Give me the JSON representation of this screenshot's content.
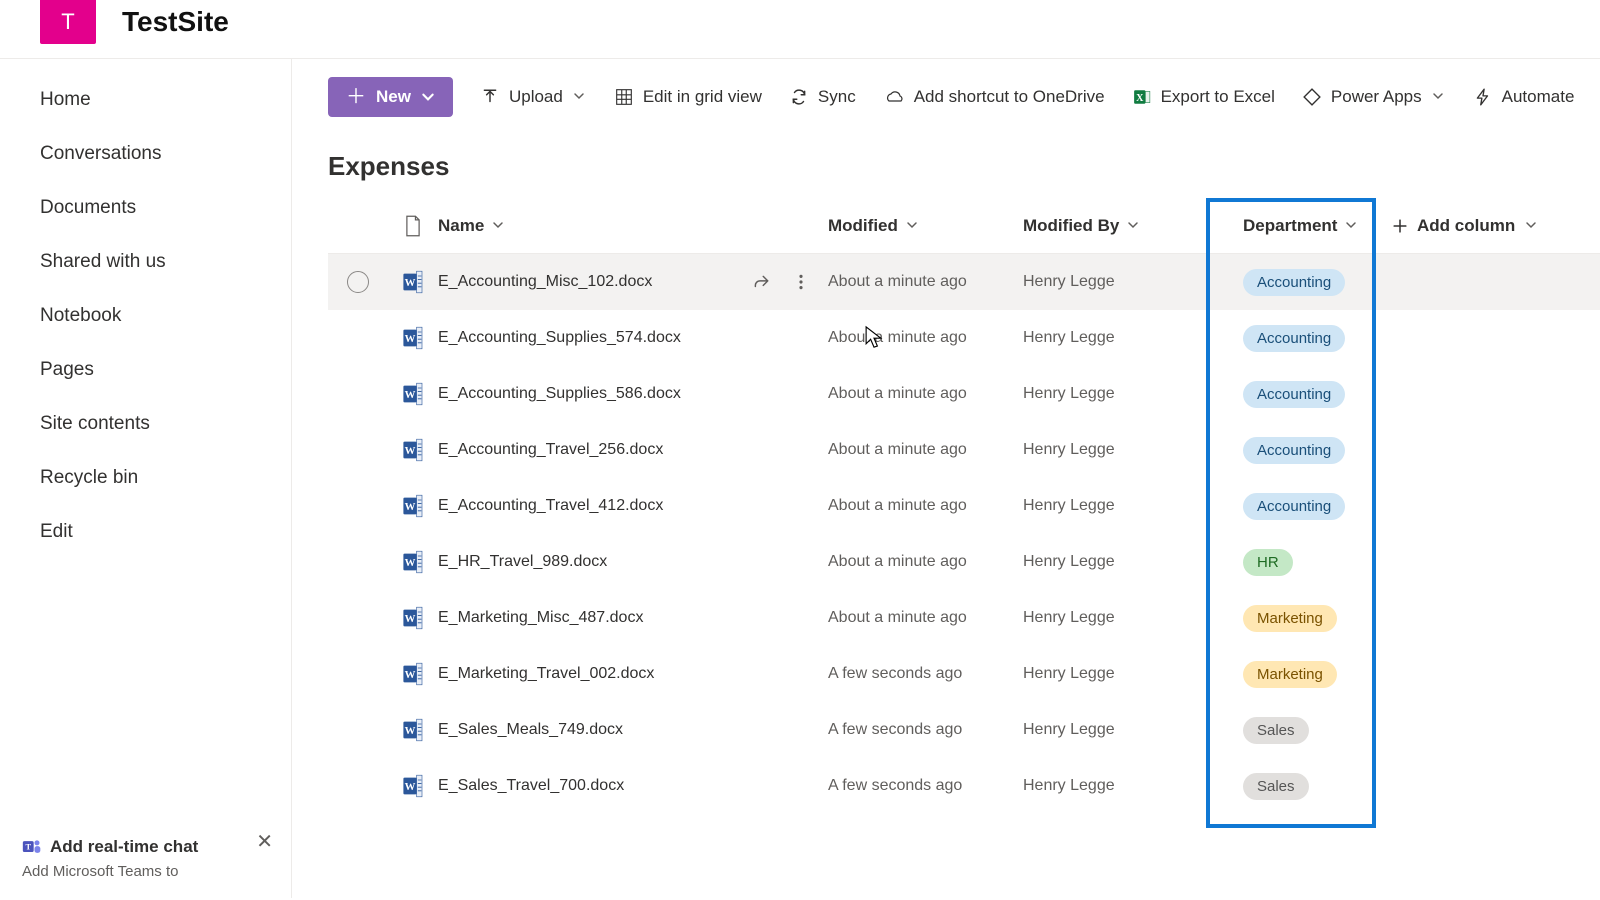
{
  "site": {
    "tile_letter": "T",
    "title": "TestSite"
  },
  "sidebar": {
    "items": [
      {
        "label": "Home"
      },
      {
        "label": "Conversations"
      },
      {
        "label": "Documents"
      },
      {
        "label": "Shared with us"
      },
      {
        "label": "Notebook"
      },
      {
        "label": "Pages"
      },
      {
        "label": "Site contents"
      },
      {
        "label": "Recycle bin"
      },
      {
        "label": "Edit"
      }
    ],
    "chat_card": {
      "title": "Add real-time chat",
      "subtitle": "Add Microsoft Teams to"
    }
  },
  "toolbar": {
    "new": "New",
    "upload": "Upload",
    "edit_grid": "Edit in grid view",
    "sync": "Sync",
    "add_shortcut": "Add shortcut to OneDrive",
    "export": "Export to Excel",
    "power_apps": "Power Apps",
    "automate": "Automate"
  },
  "list": {
    "title": "Expenses",
    "columns": {
      "name": "Name",
      "modified": "Modified",
      "modified_by": "Modified By",
      "department": "Department",
      "add_column": "Add column"
    },
    "rows": [
      {
        "name": "E_Accounting_Misc_102.docx",
        "modified": "About a minute ago",
        "by": "Henry Legge",
        "dept": "Accounting"
      },
      {
        "name": "E_Accounting_Supplies_574.docx",
        "modified": "About a minute ago",
        "by": "Henry Legge",
        "dept": "Accounting"
      },
      {
        "name": "E_Accounting_Supplies_586.docx",
        "modified": "About a minute ago",
        "by": "Henry Legge",
        "dept": "Accounting"
      },
      {
        "name": "E_Accounting_Travel_256.docx",
        "modified": "About a minute ago",
        "by": "Henry Legge",
        "dept": "Accounting"
      },
      {
        "name": "E_Accounting_Travel_412.docx",
        "modified": "About a minute ago",
        "by": "Henry Legge",
        "dept": "Accounting"
      },
      {
        "name": "E_HR_Travel_989.docx",
        "modified": "About a minute ago",
        "by": "Henry Legge",
        "dept": "HR"
      },
      {
        "name": "E_Marketing_Misc_487.docx",
        "modified": "About a minute ago",
        "by": "Henry Legge",
        "dept": "Marketing"
      },
      {
        "name": "E_Marketing_Travel_002.docx",
        "modified": "A few seconds ago",
        "by": "Henry Legge",
        "dept": "Marketing"
      },
      {
        "name": "E_Sales_Meals_749.docx",
        "modified": "A few seconds ago",
        "by": "Henry Legge",
        "dept": "Sales"
      },
      {
        "name": "E_Sales_Travel_700.docx",
        "modified": "A few seconds ago",
        "by": "Henry Legge",
        "dept": "Sales"
      }
    ]
  }
}
